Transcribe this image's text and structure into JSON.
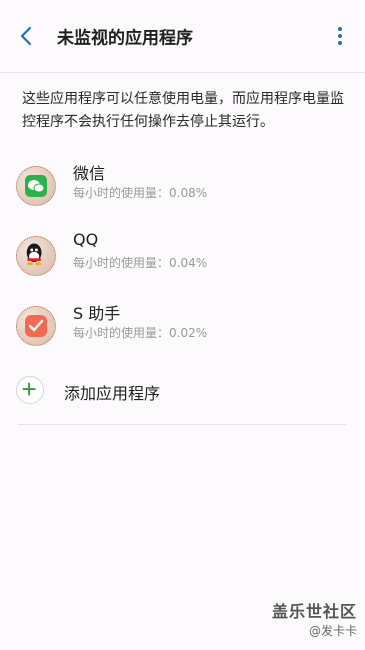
{
  "header": {
    "title": "未监视的应用程序",
    "back_icon": "back-arrow-icon",
    "menu_icon": "more-options-icon"
  },
  "description": "这些应用程序可以任意使用电量，而应用程序电量监控程序不会执行任何操作去停止其运行。",
  "apps": [
    {
      "name": "微信",
      "usage": "每小时的使用量：0.08%",
      "icon": "wechat-icon"
    },
    {
      "name": "QQ",
      "usage": "每小时的使用量：0.04%",
      "icon": "qq-icon"
    },
    {
      "name": "S 助手",
      "usage": "每小时的使用量：0.02%",
      "icon": "s-assistant-icon"
    }
  ],
  "add_action": {
    "label": "添加应用程序",
    "icon": "plus-icon"
  },
  "watermark": {
    "title": "盖乐世社区",
    "subtitle": "@发卡卡"
  },
  "colors": {
    "accent": "#1a73b8",
    "add_green": "#2e9c3a"
  }
}
